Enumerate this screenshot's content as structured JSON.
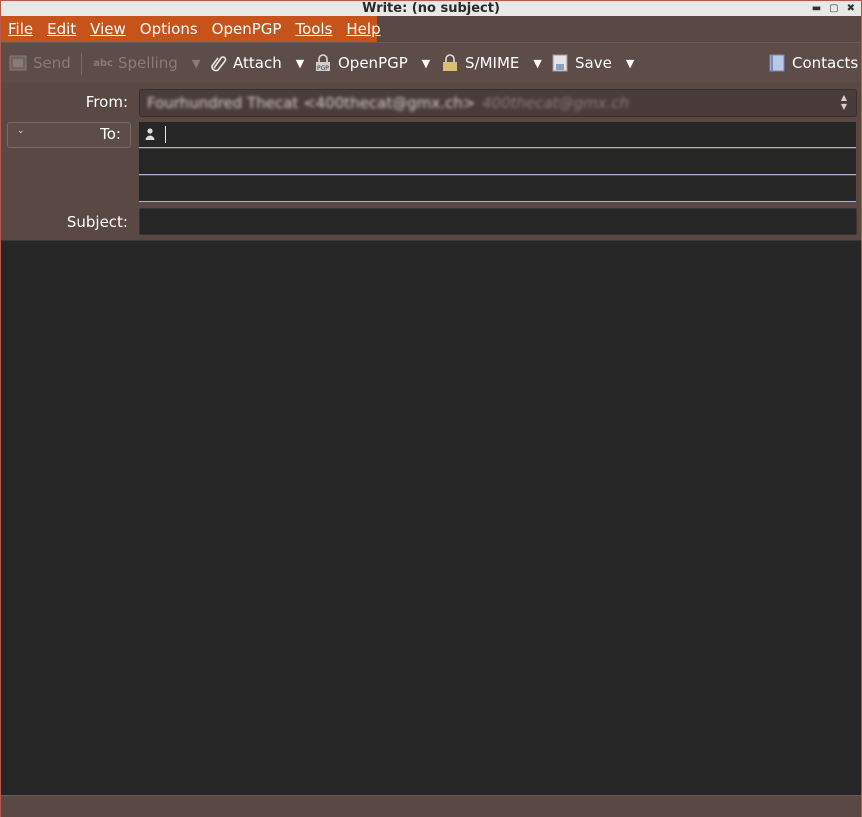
{
  "window": {
    "title": "Write: (no subject)",
    "controls": [
      "minimize-icon",
      "maximize-icon",
      "close-icon"
    ]
  },
  "menu": [
    {
      "label": "File"
    },
    {
      "label": "Edit"
    },
    {
      "label": "View"
    },
    {
      "label": "Options"
    },
    {
      "label": "OpenPGP"
    },
    {
      "label": "Tools"
    },
    {
      "label": "Help"
    }
  ],
  "toolbar": {
    "send": "Send",
    "spelling": "Spelling",
    "attach": "Attach",
    "openpgp": "OpenPGP",
    "smime": "S/MIME",
    "save": "Save",
    "contacts": "Contacts"
  },
  "header": {
    "from_label": "From:",
    "from_name": "Fourhundred Thecat <400thecat@gmx.ch>",
    "from_identity": "400thecat@gmx.ch",
    "to_label": "To:",
    "to_value": "",
    "subject_label": "Subject:",
    "subject_value": ""
  },
  "colors": {
    "menu_accent": "#c6541a",
    "chrome": "#5a4845",
    "field_bg": "#262626",
    "separator_line": "#b3b0d8"
  }
}
